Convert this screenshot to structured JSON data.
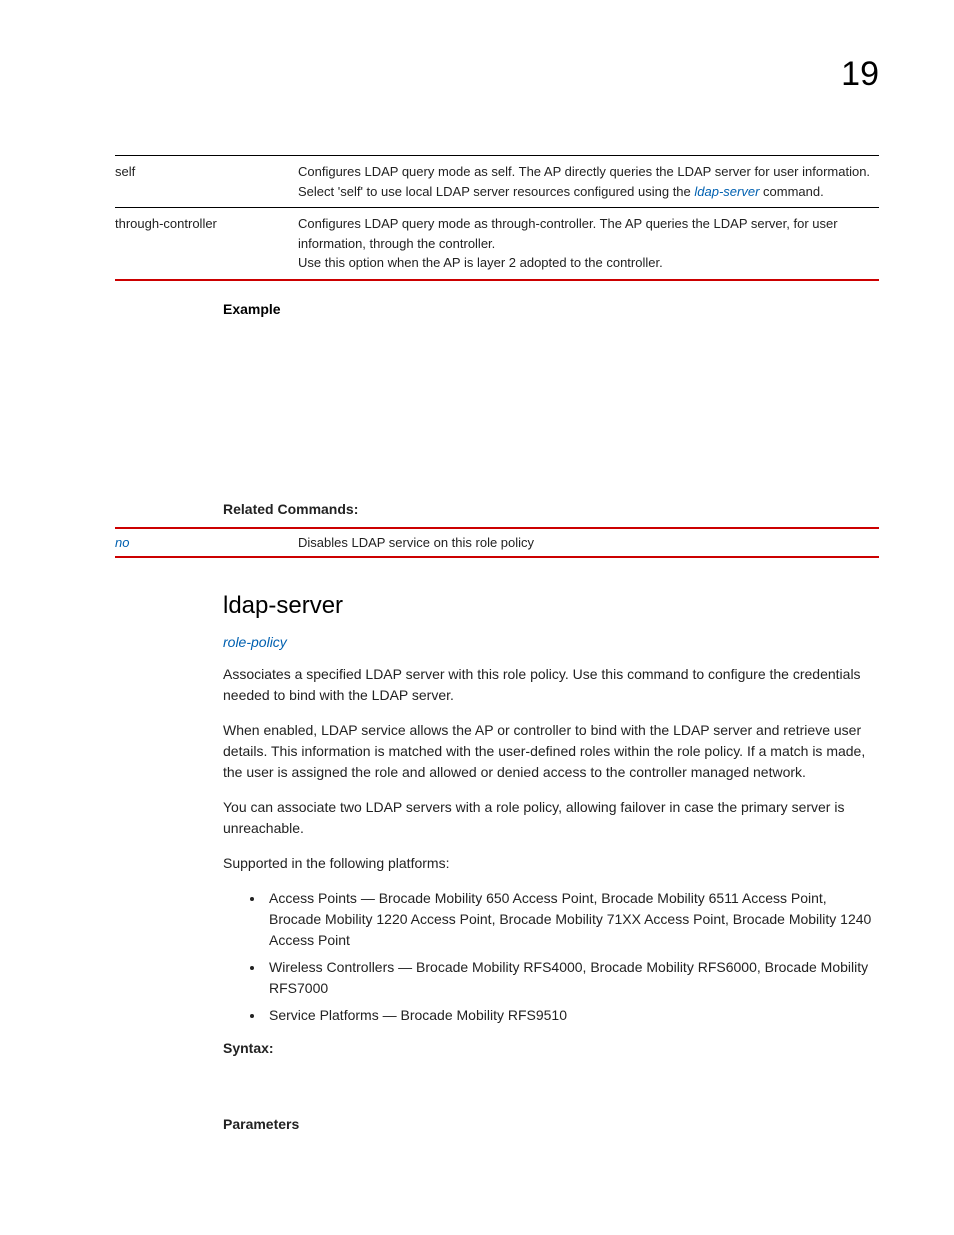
{
  "page_number": "19",
  "top_table": {
    "rows": [
      {
        "key": "self",
        "value_parts": [
          "Configures LDAP query mode as self. The AP directly queries the LDAP server for user information. Select 'self' to use local LDAP server resources configured using the ",
          "ldap-server",
          " command."
        ]
      },
      {
        "key": "through-controller",
        "value": "Configures LDAP query mode as through-controller. The AP queries the LDAP server, for user information, through the controller.\nUse this option when the AP is layer 2 adopted to the controller."
      }
    ]
  },
  "example_heading": "Example",
  "related_heading": "Related Commands:",
  "related_table": {
    "rows": [
      {
        "key": "no",
        "value": "Disables LDAP service on this role policy"
      }
    ]
  },
  "command": {
    "title": "ldap-server",
    "policy_link": "role-policy",
    "paragraphs": [
      "Associates a specified LDAP server with this role policy. Use this command to configure the credentials needed to bind with the LDAP server.",
      "When enabled, LDAP service allows the AP or controller to bind with the LDAP server and retrieve user details. This information is matched with the user-defined roles within the role policy. If a match is made, the user is assigned the role and allowed or denied access to the controller managed network.",
      "You can associate two LDAP servers with a role policy, allowing failover in case the primary server is unreachable.",
      "Supported in the following platforms:"
    ],
    "platforms": [
      "Access Points — Brocade Mobility 650 Access Point, Brocade Mobility 6511 Access Point, Brocade Mobility 1220 Access Point, Brocade Mobility 71XX Access Point, Brocade Mobility 1240 Access Point",
      "Wireless Controllers — Brocade Mobility RFS4000, Brocade Mobility RFS6000, Brocade Mobility RFS7000",
      "Service Platforms — Brocade Mobility RFS9510"
    ],
    "syntax_heading": "Syntax:",
    "parameters_heading": "Parameters"
  }
}
